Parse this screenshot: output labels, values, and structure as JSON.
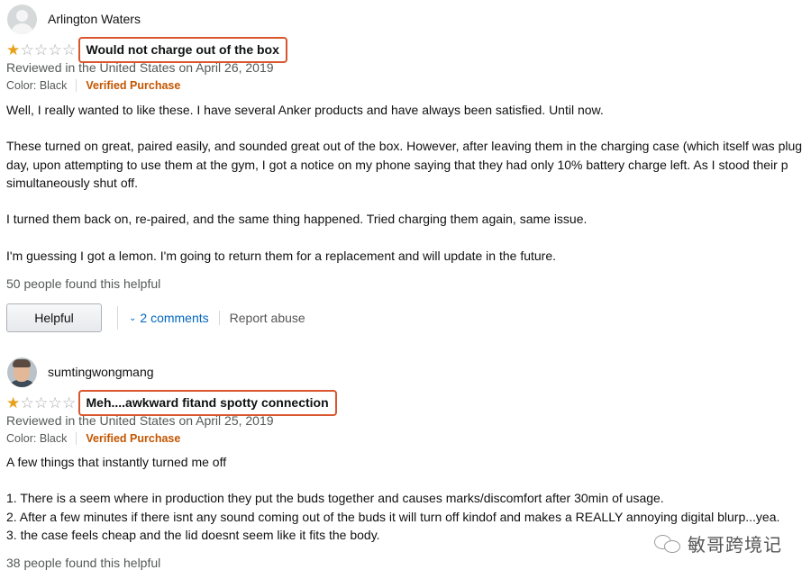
{
  "reviews": [
    {
      "profile_name": "Arlington Waters",
      "rating": 1,
      "title": "Would not charge out of the box",
      "date": "Reviewed in the United States on April 26, 2019",
      "color": "Color: Black",
      "verified": "Verified Purchase",
      "body": [
        "Well, I really wanted to like these. I have several Anker products and have always been satisfied. Until now.",
        "These turned on great, paired easily, and sounded great out of the box. However, after leaving them in the charging case (which itself was plug",
        "day, upon attempting to use them at the gym, I got a notice on my phone saying that they had only 10% battery charge left. As I stood their p",
        "simultaneously shut off.",
        "I turned them back on, re-paired, and the same thing happened. Tried charging them again, same issue.",
        "I'm guessing I got a lemon. I'm going to return them for a replacement and will update in the future."
      ],
      "helpful_count": "50 people found this helpful",
      "helpful_button": "Helpful",
      "comments": "2 comments",
      "report": "Report abuse"
    },
    {
      "profile_name": "sumtingwongmang",
      "rating": 1,
      "title": "Meh....awkward fitand spotty connection",
      "date": "Reviewed in the United States on April 25, 2019",
      "color": "Color: Black",
      "verified": "Verified Purchase",
      "body": [
        "A few things that instantly turned me off",
        "1. There is a seem where in production they put the buds together and causes marks/discomfort after 30min of usage.",
        "2. After a few minutes if there isnt any sound coming out of the buds it will turn off kindof and makes a REALLY annoying digital blurp...yea.",
        "3. the case feels cheap and the lid doesnt seem like it fits the body."
      ],
      "helpful_count": "38 people found this helpful"
    }
  ],
  "icons": {
    "star_filled": "star-filled-icon",
    "star_empty": "star-empty-icon",
    "chevron": "chevron-down-icon"
  },
  "colors": {
    "highlight_box": "#d9562e",
    "verified": "#c45500",
    "link": "#0066c0",
    "star": "#e6a019"
  },
  "watermark": "敏哥跨境记"
}
